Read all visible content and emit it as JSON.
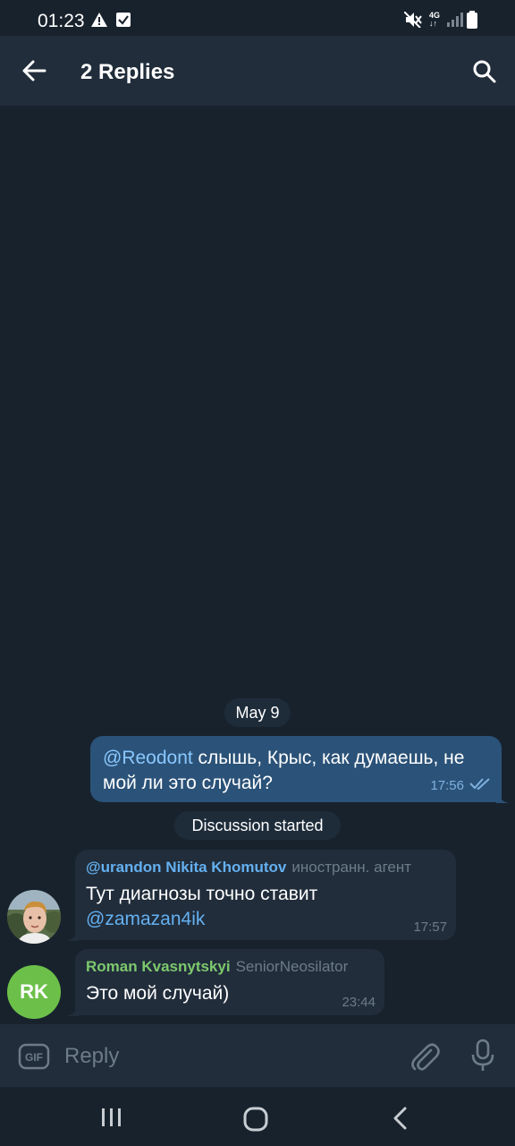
{
  "status_bar": {
    "time": "01:23",
    "network": "4G",
    "icons": [
      "warning-icon",
      "check-square-icon",
      "mute-icon",
      "signal-icon",
      "battery-icon"
    ]
  },
  "header": {
    "title": "2 Replies",
    "icons": [
      "back-arrow-icon",
      "search-icon"
    ]
  },
  "chat": {
    "date_pill": "May 9",
    "outgoing": {
      "mention": "@Reodont",
      "text": " слышь, Крыс, как думаешь, не мой ли это случай?",
      "time": "17:56",
      "status": "read-double-check-icon"
    },
    "discussion_pill": "Discussion started",
    "messages": [
      {
        "sender": "@urandon Nikita Khomutov",
        "role": "иностранн. агент",
        "text": "Тут диагнозы точно ставит",
        "mention": "@zamazan4ik",
        "time": "17:57",
        "avatar": "user-photo-avatar"
      },
      {
        "sender": "Roman Kvasnytskyi",
        "role": "SeniorNeosilator",
        "text": "Это мой случай)",
        "time": "23:44",
        "avatar_initials": "RK"
      }
    ]
  },
  "input": {
    "placeholder": "Reply",
    "gif_label": "GIF"
  },
  "colors": {
    "background": "#18222d",
    "header": "#212d3b",
    "outgoing_bubble": "#2b5278",
    "incoming_bubble": "#212d3b",
    "mention": "#64b0f0",
    "sender_green": "#7dc96d",
    "avatar_green": "#6cc04a"
  }
}
